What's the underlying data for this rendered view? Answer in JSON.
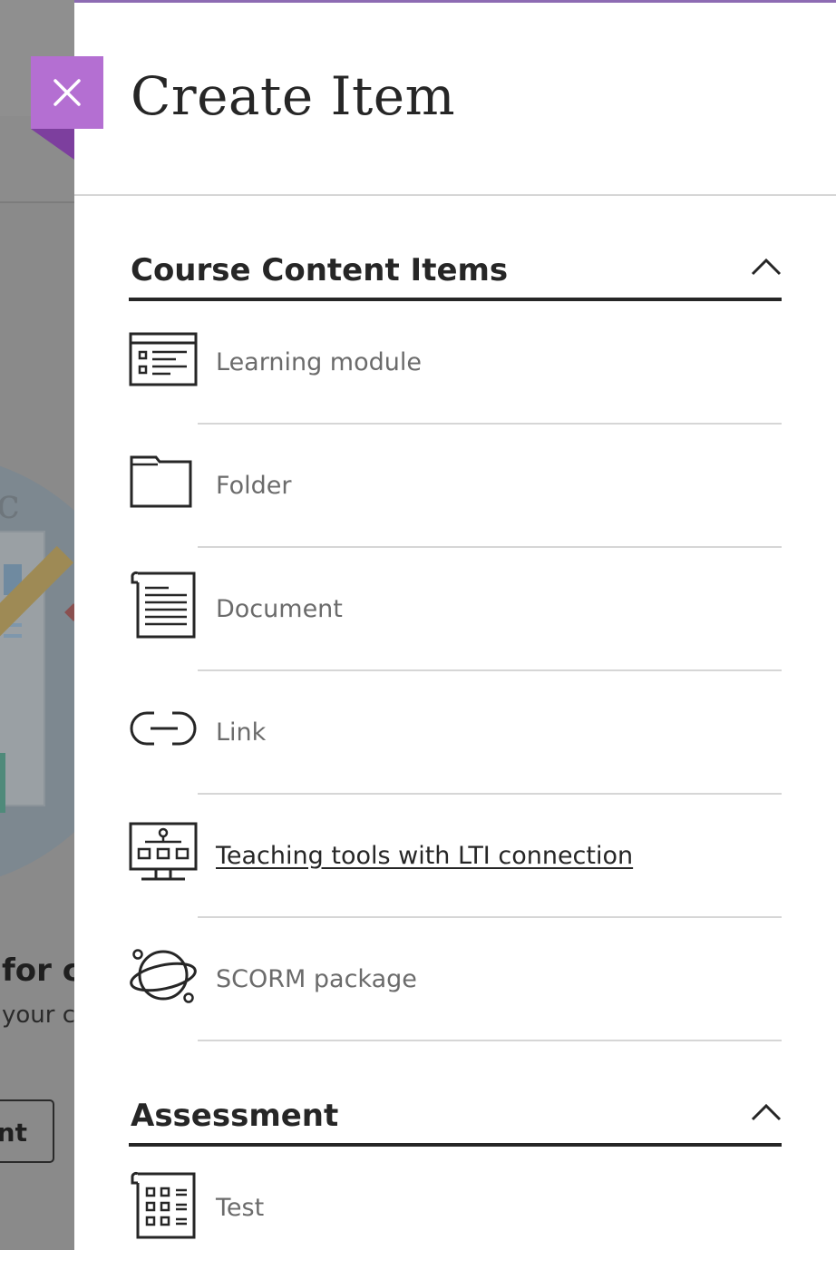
{
  "background": {
    "heading_fragment": "for c",
    "sub_fragment": "your c",
    "button_fragment": "ent"
  },
  "panel": {
    "title": "Create Item",
    "close_label": "Close",
    "accent_color": "#b46fd2"
  },
  "sections": [
    {
      "title": "Course Content Items",
      "expanded": true,
      "items": [
        {
          "label": "Learning module",
          "icon": "learning-module-icon"
        },
        {
          "label": "Folder",
          "icon": "folder-icon"
        },
        {
          "label": "Document",
          "icon": "document-icon"
        },
        {
          "label": "Link",
          "icon": "link-icon"
        },
        {
          "label": "Teaching tools with LTI connection",
          "icon": "lti-tools-icon",
          "underlined": true
        },
        {
          "label": "SCORM package",
          "icon": "scorm-package-icon"
        }
      ]
    },
    {
      "title": "Assessment",
      "expanded": true,
      "items": [
        {
          "label": "Test",
          "icon": "test-icon"
        }
      ]
    }
  ]
}
